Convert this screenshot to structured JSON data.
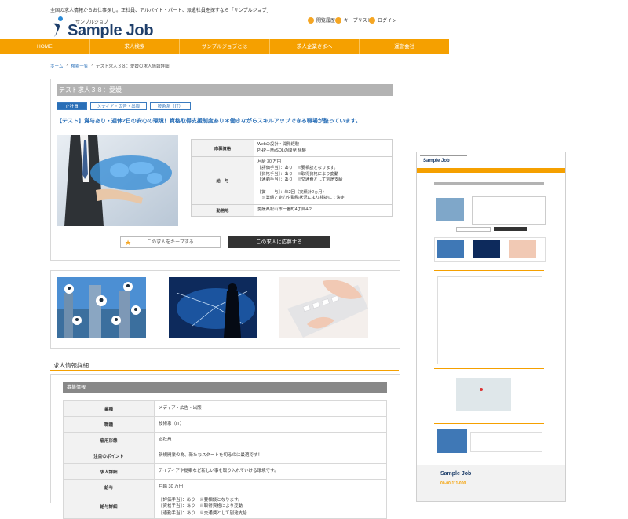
{
  "header": {
    "tagline": "全国の求人情報からお仕事探し。正社員、アルバイト・パート、派遣社員を探すなら「サンプルジョブ」",
    "logo_kana": "サンプルジョブ",
    "logo_text": "Sample Job",
    "utility": {
      "history": "閲覧履歴",
      "keep": "キープリスト",
      "login": "ログイン"
    }
  },
  "nav": [
    "HOME",
    "求人検索",
    "サンプルジョブとは",
    "求人企業さまへ",
    "運営会社"
  ],
  "breadcrumb": [
    "ホーム",
    "検索一覧",
    "テスト求人３８：愛媛の求人情報詳細"
  ],
  "job": {
    "title": "テスト求人３８：愛媛",
    "tags": [
      "正社員",
      "メディア・広告・出版",
      "技術系（IT）"
    ],
    "catch": "【テスト】賞与あり・週休2日の安心の環境！資格取得支援制度あり＊働きながらスキルアップできる職場が整っています。",
    "info": [
      {
        "label": "応募資格",
        "value": "Webの設計・開発経験\nPHP＋MySQLの開発 経験"
      },
      {
        "label": "給　与",
        "value": "月給 30 万円\n【評価手当】：あり　※要相談となります。\n【資格手当】：あり　※取得資格により変動\n【通勤手当】：あり　※交通費として別途支給\n\n【賞　　与】：年2回（実績計2ヵ月）\n　※業績と能力や勤務状況により相談にて決定"
      },
      {
        "label": "勤務地",
        "value": "愛媛県松山市一番町4丁目4-2"
      }
    ],
    "keep_label": "この求人をキープする",
    "apply_label": "この求人に応募する"
  },
  "details": {
    "section_title": "求人情報詳細",
    "subsection": "募集情報",
    "rows": [
      {
        "label": "業種",
        "value": "メディア・広告・出版"
      },
      {
        "label": "職種",
        "value": "技術系（IT）"
      },
      {
        "label": "雇用形態",
        "value": "正社員"
      },
      {
        "label": "注目のポイント",
        "value": "新規開業の為、新たなスタートを切るのに最適です！"
      },
      {
        "label": "求人詳細",
        "value": "アイディアや提案など新しい事を取り入れていける環境です。"
      },
      {
        "label": "給与",
        "value": "月給 30 万円"
      },
      {
        "label": "給与詳細",
        "value": "【評価手当】：あり　※要相談となります。\n【資格手当】：あり　※取得資格により変動\n【通勤手当】：あり　※交通費として別途支給"
      }
    ]
  },
  "mini_preview": {
    "logo_text": "Sample Job",
    "phone": "00-00-111-000"
  },
  "colors": {
    "accent": "#f5a000",
    "brand_blue": "#2a6fb7",
    "logo_navy": "#1f3f6b"
  }
}
